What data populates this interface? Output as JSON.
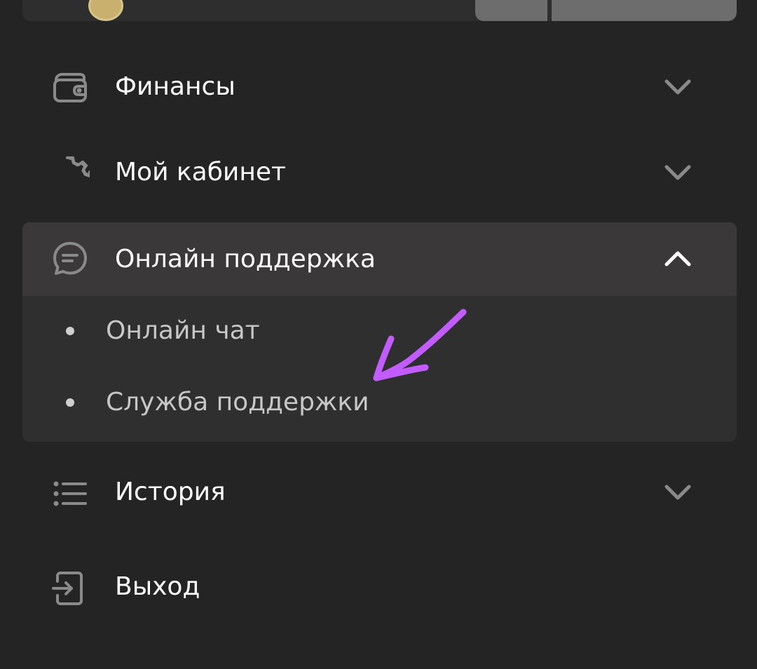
{
  "colors": {
    "background": "#242424",
    "panel": "#2f2f2f",
    "panel_header": "#3a3839",
    "icon_gray": "#8a8a8a",
    "text_primary": "#ffffff",
    "text_secondary": "#c7c7c7",
    "annotation_arrow": "#c35cff"
  },
  "menu": {
    "items": [
      {
        "label": "Финансы",
        "icon": "wallet-icon",
        "chevron": "chevron-down-icon",
        "expanded": false
      },
      {
        "label": "Мой кабинет",
        "icon": "gear-icon",
        "chevron": "chevron-down-icon",
        "expanded": false
      },
      {
        "label": "Онлайн поддержка",
        "icon": "chat-bubble-icon",
        "chevron": "chevron-up-icon",
        "expanded": true,
        "subitems": [
          {
            "label": "Онлайн чат"
          },
          {
            "label": "Служба поддержки"
          }
        ]
      },
      {
        "label": "История",
        "icon": "list-icon",
        "chevron": "chevron-down-icon",
        "expanded": false
      },
      {
        "label": "Выход",
        "icon": "logout-icon",
        "expanded": false
      }
    ]
  },
  "annotation": {
    "icon": "arrow-annotation-icon",
    "target": "Служба поддержки"
  }
}
